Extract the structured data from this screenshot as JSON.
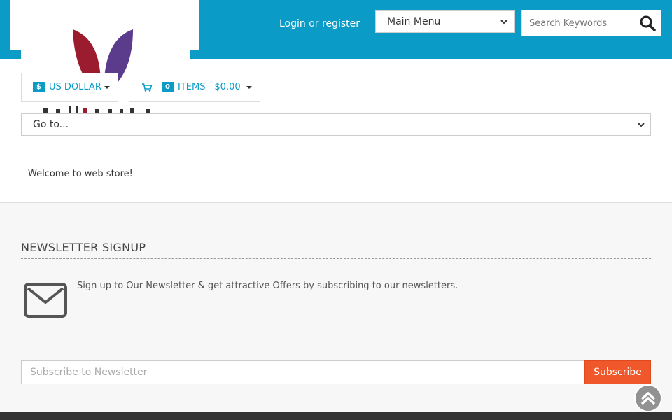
{
  "header": {
    "login_label": "Login",
    "or_label": "or",
    "register_label": "register",
    "menu_select_value": "Main Menu",
    "search_placeholder": "Search Keywords"
  },
  "toolbar": {
    "currency_symbol": "$",
    "currency_label": "US DOLLAR",
    "cart_count": "0",
    "cart_label": "ITEMS - $0.00"
  },
  "navigation": {
    "goto_value": "Go to..."
  },
  "main": {
    "welcome_text": "Welcome to web store!"
  },
  "newsletter": {
    "title": "NEWSLETTER SIGNUP",
    "description": "Sign up to Our Newsletter & get attractive Offers by subscribing to our newsletters.",
    "input_placeholder": "Subscribe to Newsletter",
    "button_label": "Subscribe"
  },
  "icons": [
    "search-icon",
    "cart-icon",
    "envelope-icon",
    "chevron-up-icon",
    "chevron-down-icon"
  ],
  "colors": {
    "brand": "#0a9bc7",
    "accent": "#f0572a",
    "footer": "#333333",
    "logo_left": "#9b1c2e",
    "logo_right": "#5a3b8c"
  }
}
